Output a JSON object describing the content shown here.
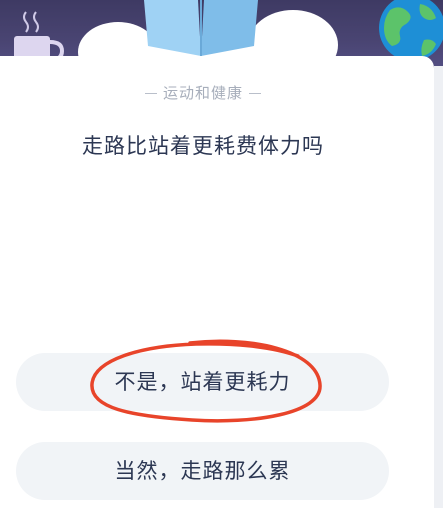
{
  "quiz": {
    "category": "运动和健康",
    "question": "走路比站着更耗费体力吗",
    "options": [
      {
        "label": "不是，站着更耗力",
        "circled": true
      },
      {
        "label": "当然，走路那么累",
        "circled": false
      }
    ]
  },
  "colors": {
    "banner_top": "#3e3a63",
    "banner_bottom": "#575289",
    "book": "#8cc7ef",
    "globe_ocean": "#1e8fd6",
    "globe_land": "#5cc36a",
    "annotation_circle": "#e8442a",
    "option_bg": "#f1f4f7",
    "text_primary": "#2c3753",
    "text_secondary": "#a7aebb"
  }
}
